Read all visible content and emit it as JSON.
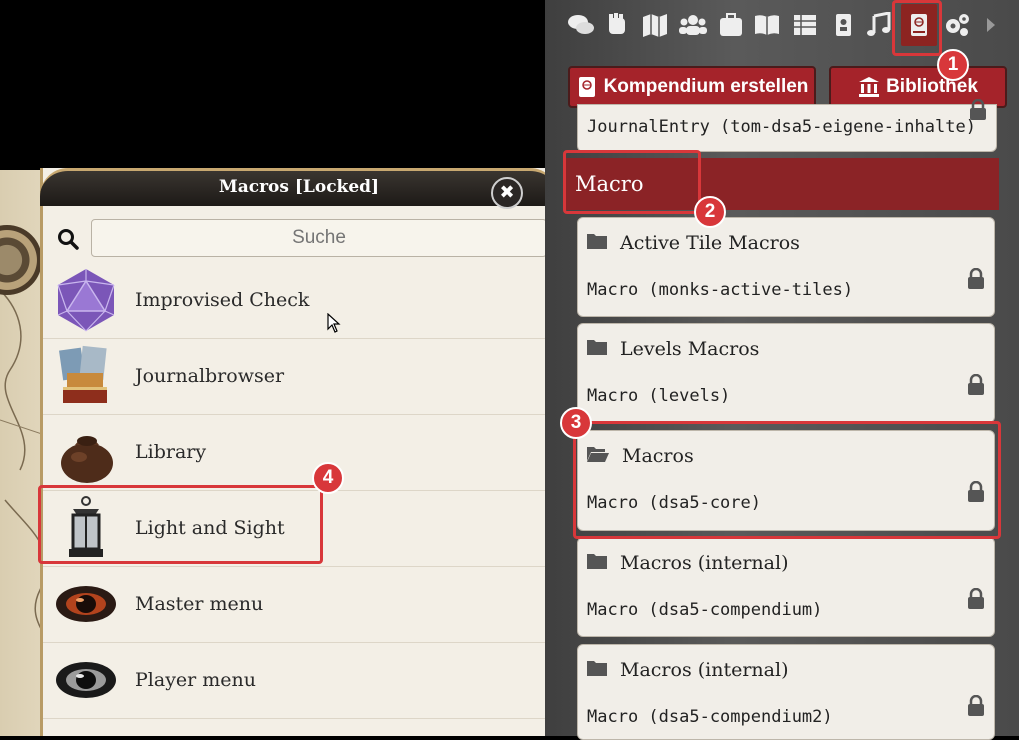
{
  "macro_window": {
    "title": "Macros [Locked]",
    "close_symbol": "✖",
    "search_placeholder": "Suche",
    "items": [
      {
        "label": "Improvised Check",
        "icon": "d20-icon"
      },
      {
        "label": "Journalbrowser",
        "icon": "books-icon"
      },
      {
        "label": "Library",
        "icon": "sack-icon"
      },
      {
        "label": "Light and Sight",
        "icon": "lantern-icon"
      },
      {
        "label": "Master menu",
        "icon": "red-eye-icon"
      },
      {
        "label": "Player menu",
        "icon": "dark-eye-icon"
      }
    ]
  },
  "sidebar": {
    "tabs": [
      "chat-icon",
      "combat-icon",
      "scenes-icon",
      "actors-icon",
      "items-icon",
      "journal-icon",
      "tables-icon",
      "cards-icon",
      "playlists-icon",
      "compendium-icon",
      "settings-icon",
      "collapse-icon"
    ],
    "create_button": "Kompendium erstellen",
    "library_button": "Bibliothek",
    "journal_entry": "JournalEntry (tom-dsa5-eigene-inhalte)",
    "section_header": "Macro",
    "packs": [
      {
        "name": "Active Tile Macros",
        "source": "Macro (monks-active-tiles)",
        "folder": "closed"
      },
      {
        "name": "Levels Macros",
        "source": "Macro (levels)",
        "folder": "closed"
      },
      {
        "name": "Macros",
        "source": "Macro (dsa5-core)",
        "folder": "open"
      },
      {
        "name": "Macros (internal)",
        "source": "Macro (dsa5-compendium)",
        "folder": "closed"
      },
      {
        "name": "Macros (internal)",
        "source": "Macro (dsa5-compendium2)",
        "folder": "closed"
      }
    ]
  },
  "annotations": {
    "steps": [
      "1",
      "2",
      "3",
      "4"
    ],
    "highlight_color": "#d8373a"
  },
  "colors": {
    "accent_red": "#a5232a",
    "header_red": "#8b2326",
    "parchment": "#f3efe6"
  }
}
